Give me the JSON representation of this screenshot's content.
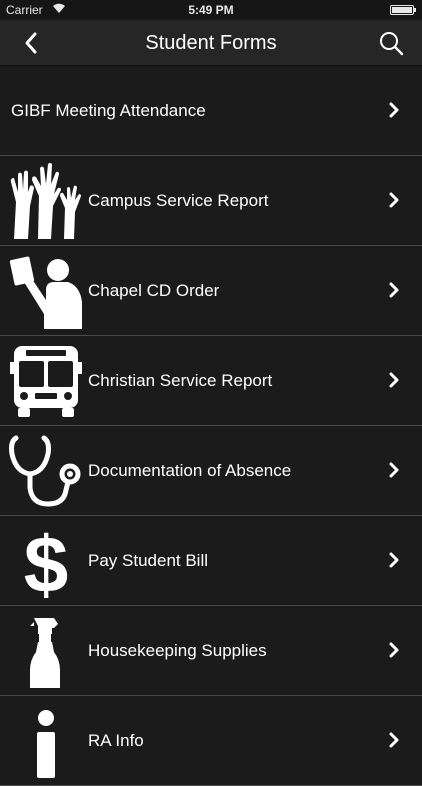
{
  "status": {
    "carrier": "Carrier",
    "time": "5:49 PM"
  },
  "nav": {
    "title": "Student Forms"
  },
  "items": [
    {
      "label": "GIBF Meeting Attendance",
      "icon": "none"
    },
    {
      "label": "Campus Service Report",
      "icon": "raised-hands-icon"
    },
    {
      "label": "Chapel CD Order",
      "icon": "person-holding-cd-icon"
    },
    {
      "label": "Christian Service Report",
      "icon": "bus-icon"
    },
    {
      "label": "Documentation of Absence",
      "icon": "stethoscope-icon"
    },
    {
      "label": "Pay Student Bill",
      "icon": "dollar-icon"
    },
    {
      "label": "Housekeeping Supplies",
      "icon": "spray-bottle-icon"
    },
    {
      "label": "RA Info",
      "icon": "info-icon"
    }
  ]
}
